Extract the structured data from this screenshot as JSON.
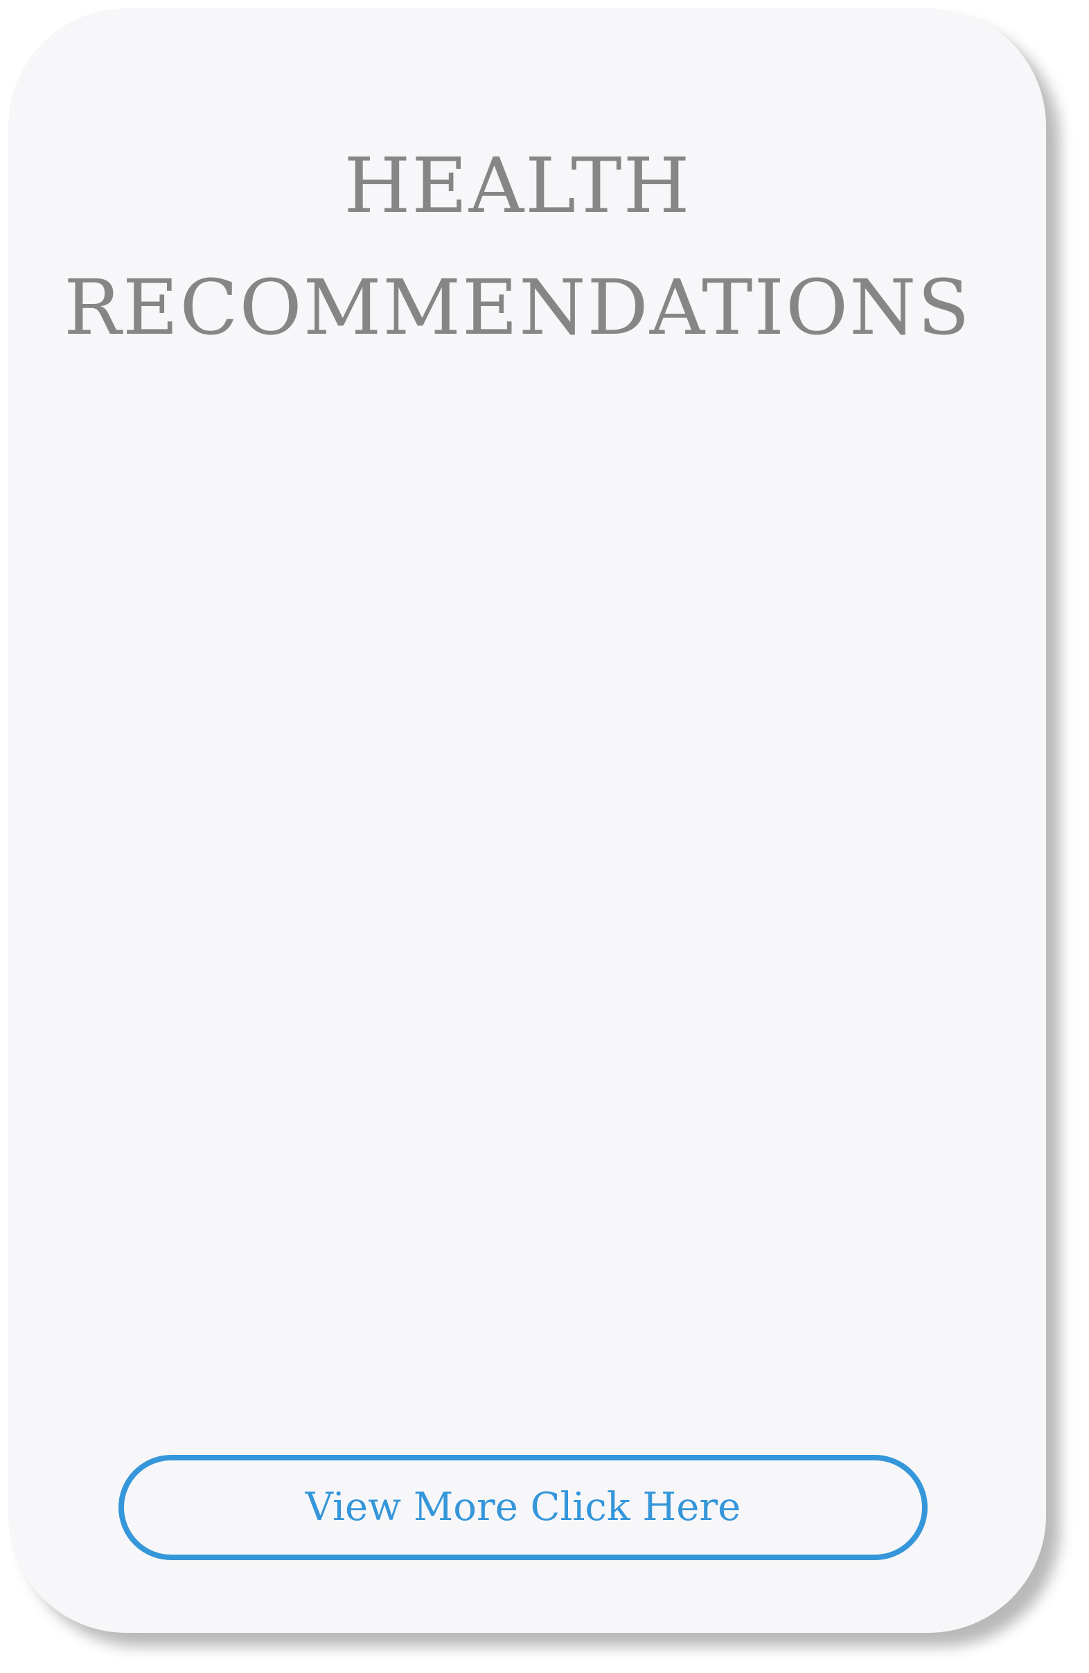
{
  "card": {
    "title_line1": "HEALTH",
    "title_line2": "RECOMMENDATIONS",
    "button_label": "View More Click Here"
  },
  "colors": {
    "background": "#f7f7f9",
    "title": "#868686",
    "accent": "#3596da"
  }
}
